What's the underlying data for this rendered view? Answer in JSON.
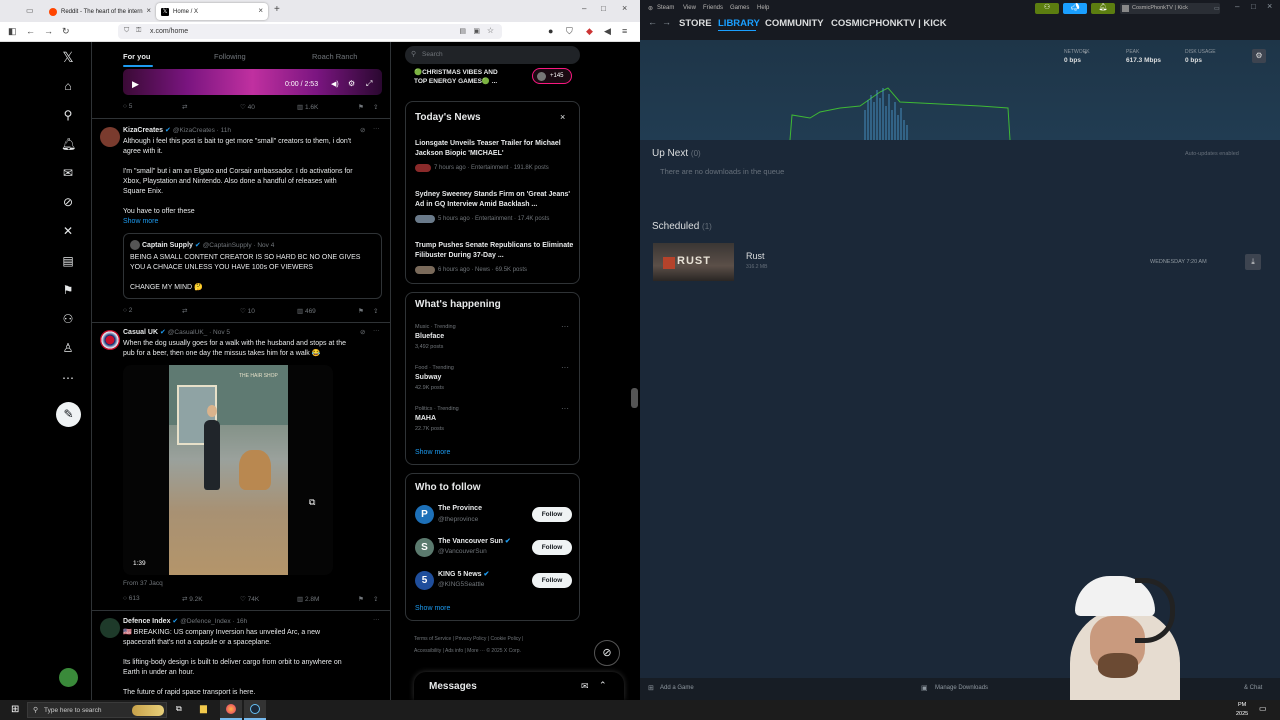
{
  "browser": {
    "tabs": [
      {
        "title": "Reddit - The heart of the intern",
        "active": false
      },
      {
        "title": "Home / X",
        "active": true
      }
    ],
    "url": "x.com/home"
  },
  "x": {
    "timeline_tabs": [
      "For you",
      "Following",
      "Roach Ranch"
    ],
    "video_time": "0:00 / 2:53",
    "post0_stats": {
      "replies": "5",
      "likes": "40",
      "views": "1.6K"
    },
    "post1": {
      "name": "KizaCreates",
      "handle": "@KizaCreates · 11h",
      "lines": [
        "Although i feel this post is bait to get more \"small\" creators to them, i don't",
        "agree with it.",
        "",
        "I'm \"small\" but i am an Elgato and Corsair ambassador. I do activations for",
        "Xbox, Playstation and Nintendo. Also done a handful of releases with",
        "Square Enix.",
        "",
        "You have to offer these"
      ],
      "show_more": "Show more",
      "quote": {
        "name": "Captain Supply",
        "handle": "@CaptainSupply · Nov 4",
        "lines": [
          "BEING A SMALL CONTENT CREATOR IS SO HARD BC NO ONE GIVES",
          "YOU A CHNACE UNLESS YOU HAVE 100s OF VIEWERS",
          "",
          "CHANGE MY MIND 🤔"
        ]
      },
      "stats": {
        "replies": "2",
        "likes": "10",
        "views": "469"
      }
    },
    "post2": {
      "name": "Casual UK",
      "handle": "@CasualUK_ · Nov 5",
      "lines": [
        "When the dog usually goes for a walk with the husband and stops at the",
        "pub for a beer, then one day the missus takes him for a walk 😂"
      ],
      "video_duration": "1:39",
      "from": "From 37 Jacq",
      "shop_sign": "THE HAIR SHOP",
      "stats": {
        "replies": "613",
        "reposts": "9.2K",
        "likes": "74K",
        "views": "2.8M"
      }
    },
    "post3": {
      "name": "Defence Index",
      "handle": "@Defence_Index · 16h",
      "lines": [
        "🇺🇸 BREAKING: US company Inversion has unveiled Arc, a new",
        "spacecraft that's not a capsule or a spaceplane.",
        "",
        "Its lifting-body design is built to deliver cargo from orbit to anywhere on",
        "Earth in under an hour.",
        "",
        "The future of rapid space transport is here."
      ]
    },
    "search_placeholder": "Search",
    "live_space": {
      "title_line1": "🟢CHRISTMAS VIBES AND",
      "title_line2": "TOP ENERGY GAMES🟢 ...",
      "count": "+145"
    },
    "news": {
      "title": "Today's News",
      "items": [
        {
          "title": "Lionsgate Unveils Teaser Trailer for Michael Jackson Biopic 'MICHAEL'",
          "meta": "7 hours ago · Entertainment · 191.8K posts"
        },
        {
          "title": "Sydney Sweeney Stands Firm on 'Great Jeans' Ad in GQ Interview Amid Backlash ...",
          "meta": "5 hours ago · Entertainment · 17.4K posts"
        },
        {
          "title": "Trump Pushes Senate Republicans to Eliminate Filibuster During 37-Day ...",
          "meta": "6 hours ago · News · 69.5K posts"
        }
      ]
    },
    "happening": {
      "title": "What's happening",
      "items": [
        {
          "category": "Music · Trending",
          "name": "Blueface",
          "posts": "3,492 posts"
        },
        {
          "category": "Food · Trending",
          "name": "Subway",
          "posts": "42.9K posts"
        },
        {
          "category": "Politics · Trending",
          "name": "MAHA",
          "posts": "22.7K posts"
        }
      ],
      "show_more": "Show more"
    },
    "follow": {
      "title": "Who to follow",
      "button": "Follow",
      "items": [
        {
          "name": "The Province",
          "handle": "@theprovince",
          "color": "#1d70b8",
          "letter": "P"
        },
        {
          "name": "The Vancouver Sun",
          "handle": "@VancouverSun",
          "color": "#5b7a6e",
          "letter": "S"
        },
        {
          "name": "KING 5 News",
          "handle": "@KING5Seattle",
          "color": "#1f4e9c",
          "letter": "5"
        }
      ],
      "show_more": "Show more"
    },
    "footer_line1": "Terms of Service  |  Privacy Policy  |  Cookie Policy  |",
    "footer_line2": "Accessibility  |  Ads info  |  More ···  © 2025 X Corp.",
    "messages": "Messages"
  },
  "steam": {
    "menu": [
      "Steam",
      "View",
      "Friends",
      "Games",
      "Help"
    ],
    "nav": [
      "STORE",
      "LIBRARY",
      "COMMUNITY",
      "COSMICPHONKTV | KICK"
    ],
    "account": "CosmicPhonkTV | Kick",
    "stats": [
      {
        "label": "NETWORK",
        "value": "0 bps"
      },
      {
        "label": "PEAK",
        "value": "617.3 Mbps"
      },
      {
        "label": "DISK USAGE",
        "value": "0 bps"
      }
    ],
    "up_next": {
      "title": "Up Next",
      "count": "(0)",
      "auto": "Auto-updates enabled",
      "empty": "There are no downloads in the queue"
    },
    "scheduled": {
      "title": "Scheduled",
      "count": "(1)",
      "game": "Rust",
      "size": "316.2 MB",
      "time": "WEDNESDAY 7:20 AM",
      "thumb_text": "RUST"
    },
    "bottom": {
      "add": "Add a Game",
      "manage": "Manage Downloads",
      "chat": "& Chat"
    },
    "accent": "#1a9fff"
  },
  "taskbar": {
    "search_placeholder": "Type here to search",
    "time": "PM",
    "date": "2025"
  }
}
